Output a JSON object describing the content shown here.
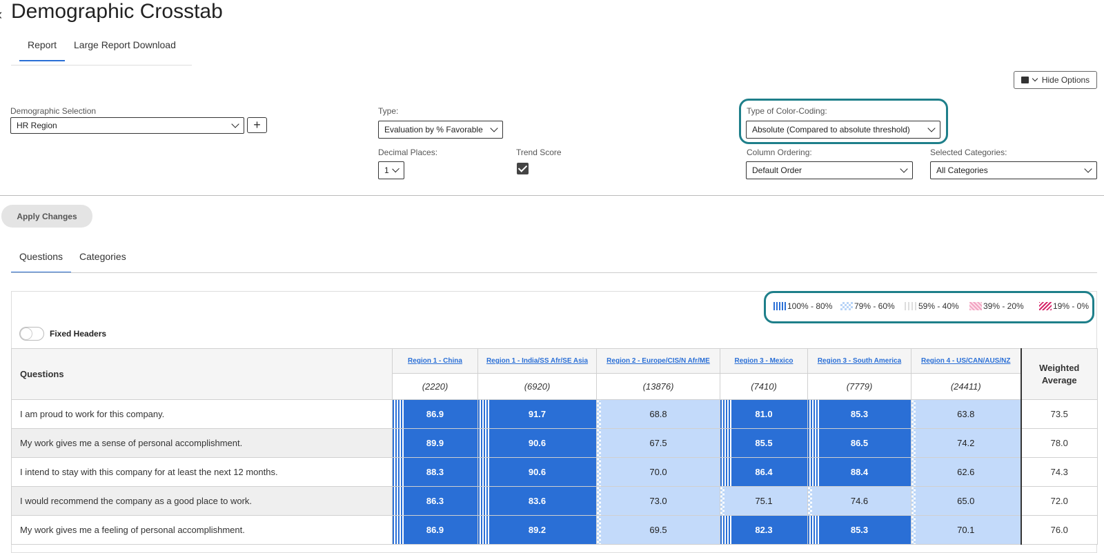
{
  "page": {
    "title": "Demographic Crosstab",
    "back_icon": "chevron-left-icon"
  },
  "top_tabs": [
    {
      "label": "Report",
      "active": true
    },
    {
      "label": "Large Report Download",
      "active": false
    }
  ],
  "hide_options": {
    "label": "Hide Options"
  },
  "options": {
    "demographic": {
      "label": "Demographic Selection",
      "value": "HR Region"
    },
    "type": {
      "label": "Type:",
      "value": "Evaluation by % Favorable"
    },
    "color_coding": {
      "label": "Type of Color-Coding:",
      "value": "Absolute (Compared to absolute threshold)"
    },
    "decimal_places": {
      "label": "Decimal Places:",
      "value": "1"
    },
    "trend_score": {
      "label": "Trend Score",
      "checked": true
    },
    "column_ordering": {
      "label": "Column Ordering:",
      "value": "Default Order"
    },
    "selected_categories": {
      "label": "Selected Categories:",
      "value": "All Categories"
    }
  },
  "apply_changes": {
    "label": "Apply Changes"
  },
  "result_tabs": [
    {
      "label": "Questions",
      "active": true
    },
    {
      "label": "Categories",
      "active": false
    }
  ],
  "legend": [
    {
      "label": "100% - 80%",
      "color": "#2a6fd6"
    },
    {
      "label": "79% - 60%",
      "color": "#b8d4f7"
    },
    {
      "label": "59% - 40%",
      "color": "#dddddd"
    },
    {
      "label": "39% - 20%",
      "color": "#f2a3c2"
    },
    {
      "label": "19% - 0%",
      "color": "#d6256a"
    }
  ],
  "fixed_headers": {
    "label": "Fixed Headers",
    "on": false
  },
  "table": {
    "questions_header": "Questions",
    "weighted_header": "Weighted Average",
    "regions": [
      {
        "name": "Region 1 - China",
        "count": "(2220)"
      },
      {
        "name": "Region 1 - India/SS Afr/SE Asia",
        "count": "(6920)"
      },
      {
        "name": "Region 2 - Europe/CIS/N Afr/ME",
        "count": "(13876)"
      },
      {
        "name": "Region 3 - Mexico",
        "count": "(7410)"
      },
      {
        "name": "Region 3 - South America",
        "count": "(7779)"
      },
      {
        "name": "Region 4 - US/CAN/AUS/NZ",
        "count": "(24411)"
      }
    ],
    "rows": [
      {
        "question": "I am proud to work for this company.",
        "values": [
          "86.9",
          "91.7",
          "68.8",
          "81.0",
          "85.3",
          "63.8"
        ],
        "weighted": "73.5"
      },
      {
        "question": "My work gives me a sense of personal accomplishment.",
        "values": [
          "89.9",
          "90.6",
          "67.5",
          "85.5",
          "86.5",
          "74.2"
        ],
        "weighted": "78.0"
      },
      {
        "question": "I intend to stay with this company for at least the next 12 months.",
        "values": [
          "88.3",
          "90.6",
          "70.0",
          "86.4",
          "88.4",
          "62.6"
        ],
        "weighted": "74.3"
      },
      {
        "question": "I would recommend the company as a good place to work.",
        "values": [
          "86.3",
          "83.6",
          "73.0",
          "75.1",
          "74.6",
          "65.0"
        ],
        "weighted": "72.0"
      },
      {
        "question": "My work gives me a feeling of personal accomplishment.",
        "values": [
          "86.9",
          "89.2",
          "69.5",
          "82.3",
          "85.3",
          "70.1"
        ],
        "weighted": "76.0"
      }
    ]
  }
}
